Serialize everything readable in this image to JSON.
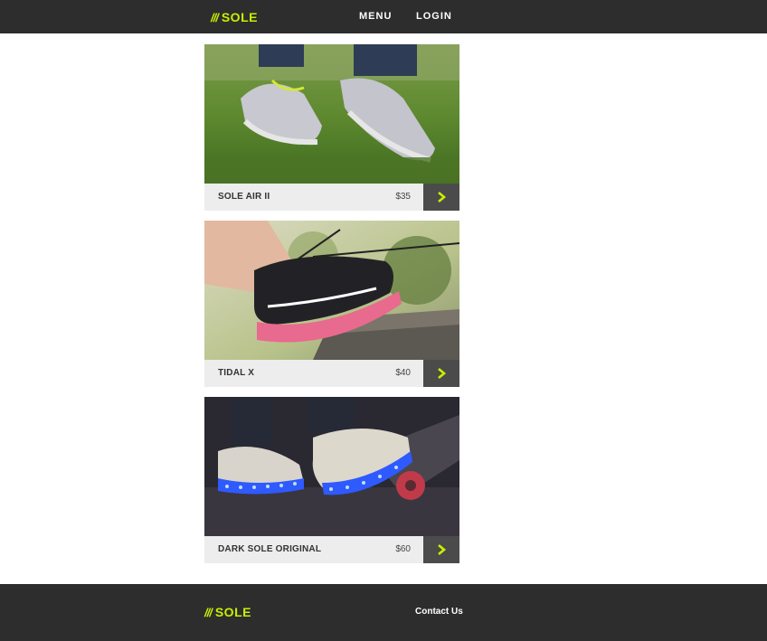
{
  "header": {
    "logo_slashes": "///",
    "logo_text": "SOLE",
    "nav": {
      "menu": "MENU",
      "login": "LOGIN"
    }
  },
  "products": [
    {
      "name": "SOLE AIR II",
      "price": "$35"
    },
    {
      "name": "TIDAL X",
      "price": "$40"
    },
    {
      "name": "DARK SOLE ORIGINAL",
      "price": "$60"
    }
  ],
  "footer": {
    "logo_slashes": "///",
    "logo_text": "SOLE",
    "contact": "Contact Us"
  },
  "colors": {
    "bar_bg": "#2d2d2d",
    "accent": "#c8f000",
    "card_label_bg": "#ededed",
    "arrow_bg": "#4b4b4b"
  },
  "icons": {
    "arrow": "chevron-right-icon"
  }
}
